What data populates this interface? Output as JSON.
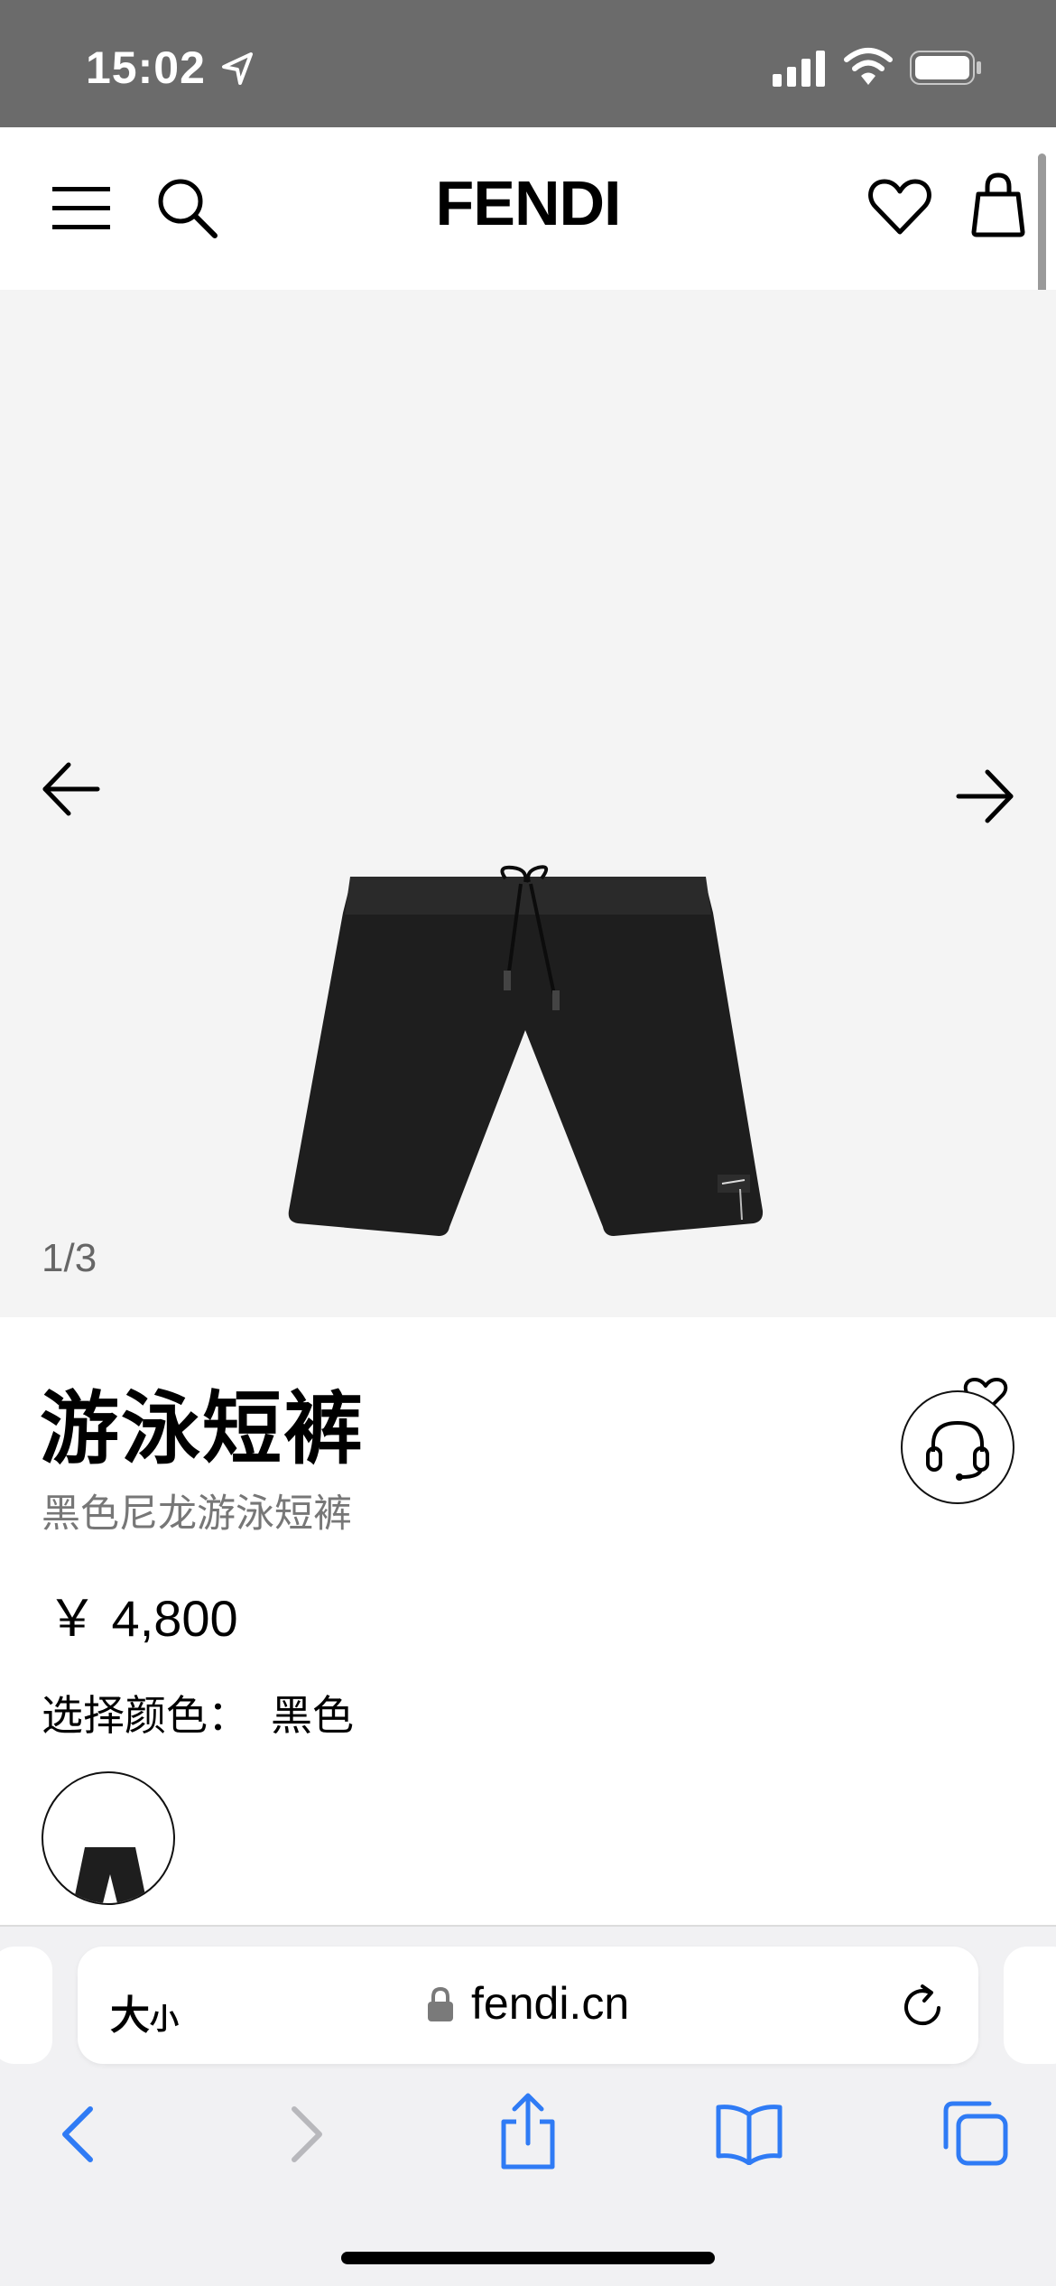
{
  "status_bar": {
    "time": "15:02"
  },
  "header": {
    "logo": "FENDI",
    "icons": [
      "menu-icon",
      "search-icon",
      "heart-icon",
      "shopping-bag-icon"
    ]
  },
  "gallery": {
    "counter": "1/3"
  },
  "product": {
    "title": "游泳短裤",
    "subtitle": "黑色尼龙游泳短裤",
    "price": "￥ 4,800",
    "color_label": "选择颜色：",
    "color_value": "黑色"
  },
  "browser": {
    "text_size_big": "大",
    "text_size_small": "小",
    "url": "fendi.cn"
  },
  "colors": {
    "accent_blue": "#2f7bf5",
    "status_bar_bg": "#6b6b6b",
    "gallery_bg": "#f4f4f4"
  }
}
